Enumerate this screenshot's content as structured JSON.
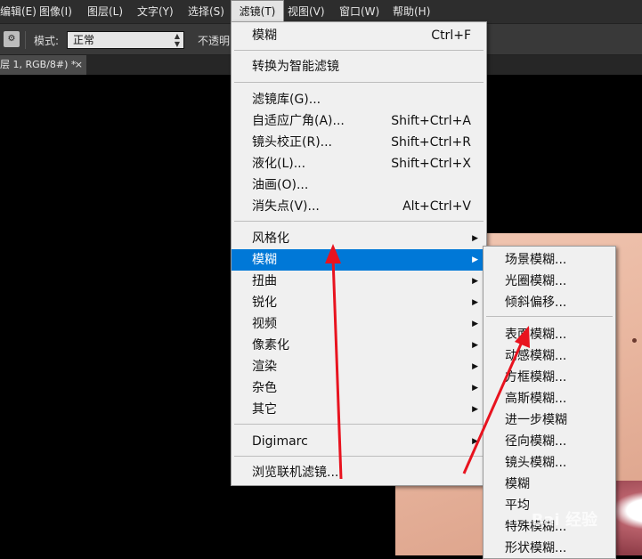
{
  "menubar": {
    "items": [
      {
        "label": "编辑(E)"
      },
      {
        "label": "图像(I)"
      },
      {
        "label": "图层(L)"
      },
      {
        "label": "文字(Y)"
      },
      {
        "label": "选择(S)"
      },
      {
        "label": "滤镜(T)"
      },
      {
        "label": "视图(V)"
      },
      {
        "label": "窗口(W)"
      },
      {
        "label": "帮助(H)"
      }
    ]
  },
  "options": {
    "mode_label": "模式:",
    "mode_value": "正常",
    "opacity_label": "不透明"
  },
  "document_tab": {
    "title": "层 1, RGB/8#) *",
    "close": "×"
  },
  "filter_menu": {
    "groups": [
      [
        {
          "label": "模糊",
          "shortcut": "Ctrl+F"
        }
      ],
      [
        {
          "label": "转换为智能滤镜",
          "shortcut": ""
        }
      ],
      [
        {
          "label": "滤镜库(G)...",
          "shortcut": ""
        },
        {
          "label": "自适应广角(A)...",
          "shortcut": "Shift+Ctrl+A"
        },
        {
          "label": "镜头校正(R)...",
          "shortcut": "Shift+Ctrl+R"
        },
        {
          "label": "液化(L)...",
          "shortcut": "Shift+Ctrl+X"
        },
        {
          "label": "油画(O)...",
          "shortcut": ""
        },
        {
          "label": "消失点(V)...",
          "shortcut": "Alt+Ctrl+V"
        }
      ],
      [
        {
          "label": "风格化",
          "submenu": true
        },
        {
          "label": "模糊",
          "submenu": true,
          "highlighted": true
        },
        {
          "label": "扭曲",
          "submenu": true
        },
        {
          "label": "锐化",
          "submenu": true
        },
        {
          "label": "视频",
          "submenu": true
        },
        {
          "label": "像素化",
          "submenu": true
        },
        {
          "label": "渲染",
          "submenu": true
        },
        {
          "label": "杂色",
          "submenu": true
        },
        {
          "label": "其它",
          "submenu": true
        }
      ],
      [
        {
          "label": "Digimarc",
          "submenu": true
        }
      ],
      [
        {
          "label": "浏览联机滤镜...",
          "shortcut": ""
        }
      ]
    ]
  },
  "blur_submenu": {
    "items_top": [
      {
        "label": "场景模糊..."
      },
      {
        "label": "光圈模糊..."
      },
      {
        "label": "倾斜偏移..."
      }
    ],
    "items_bottom": [
      {
        "label": "表面模糊..."
      },
      {
        "label": "动感模糊..."
      },
      {
        "label": "方框模糊..."
      },
      {
        "label": "高斯模糊..."
      },
      {
        "label": "进一步模糊"
      },
      {
        "label": "径向模糊..."
      },
      {
        "label": "镜头模糊..."
      },
      {
        "label": "模糊"
      },
      {
        "label": "平均"
      },
      {
        "label": "特殊模糊..."
      },
      {
        "label": "形状模糊..."
      }
    ]
  },
  "watermark": "Bai 经验",
  "colors": {
    "highlight": "#0078d7",
    "annotation": "#e8131f",
    "menu_bg": "#f0f0f0"
  }
}
